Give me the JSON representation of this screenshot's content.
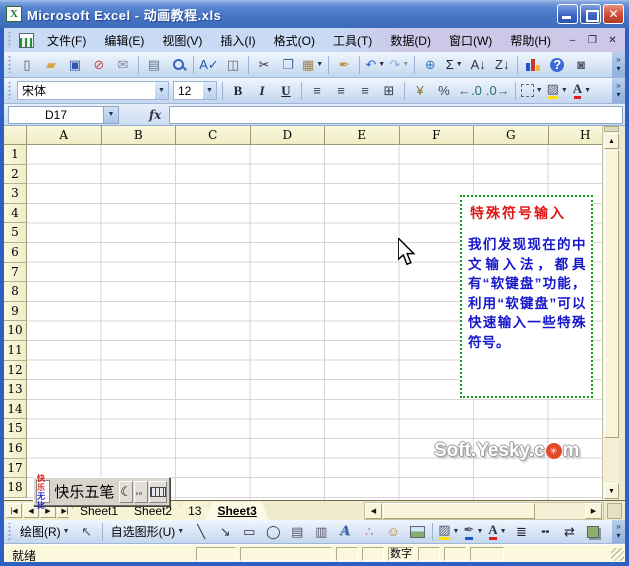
{
  "window": {
    "title": "Microsoft Excel - 动画教程.xls",
    "app_icon_glyph": "X"
  },
  "icons": {
    "dd": "▼",
    "up": "▲",
    "down": "▼",
    "left": "◀",
    "right": "▶"
  },
  "toolbar_overflow": {
    "top": "»",
    "bottom": "▾"
  },
  "colors": {
    "titlebar_blue": "#4674C4",
    "header_yellow": "#F6F3CF",
    "note_border": "#12A012",
    "note_title": "#E01818",
    "note_body": "#1515CC",
    "watermark_red": "#E24A2A",
    "fill_yellow": "#FFE400",
    "font_red": "#E02020",
    "line_blue": "#2255CC"
  },
  "menu_bar": {
    "items": [
      "文件(F)",
      "编辑(E)",
      "视图(V)",
      "插入(I)",
      "格式(O)",
      "工具(T)",
      "数据(D)",
      "窗口(W)",
      "帮助(H)"
    ],
    "window_buttons": [
      "–",
      "❐",
      "✕"
    ]
  },
  "standard_toolbar": {
    "items": [
      {
        "name": "new",
        "glyph": "▯",
        "color": "#556"
      },
      {
        "name": "open",
        "glyph": "▰",
        "color": "#D9A43B"
      },
      {
        "name": "save",
        "glyph": "▣",
        "color": "#3458A8"
      },
      {
        "name": "permission",
        "glyph": "⊘",
        "color": "#C44"
      },
      {
        "name": "mail",
        "glyph": "✉",
        "color": "#7A88A8"
      },
      {
        "sep": true
      },
      {
        "name": "print",
        "glyph": "▤",
        "color": "#66788C"
      },
      {
        "name": "print-preview",
        "cls": "ic-magnifier"
      },
      {
        "sep": true
      },
      {
        "name": "spelling",
        "glyph": "A✓",
        "color": "#2255AA"
      },
      {
        "name": "research",
        "glyph": "◫",
        "color": "#667"
      },
      {
        "sep": true
      },
      {
        "name": "cut",
        "glyph": "✂",
        "color": "#334"
      },
      {
        "name": "copy",
        "glyph": "❐",
        "color": "#4A6FA5"
      },
      {
        "name": "paste",
        "glyph": "▦",
        "color": "#A0824A",
        "dd": true
      },
      {
        "sep": true
      },
      {
        "name": "format-painter",
        "glyph": "✒",
        "color": "#B8953A"
      },
      {
        "sep": true
      },
      {
        "name": "undo",
        "glyph": "↶",
        "color": "#2E62C8",
        "dd": true
      },
      {
        "name": "redo",
        "glyph": "↷",
        "color": "#2E62C8",
        "dd": true,
        "dis": true
      },
      {
        "sep": true
      },
      {
        "name": "hyperlink",
        "glyph": "⊕",
        "color": "#3A7AC8"
      },
      {
        "name": "autosum",
        "glyph": "Σ",
        "color": "#222",
        "dd": true
      },
      {
        "name": "sort-ascending",
        "glyph": "A↓",
        "color": "#334"
      },
      {
        "name": "sort-descending",
        "glyph": "Z↓",
        "color": "#334"
      },
      {
        "sep": true
      },
      {
        "name": "chart-wizard",
        "cls": "ic-chart"
      },
      {
        "name": "help",
        "glyph": "?",
        "cls": "ic-help"
      },
      {
        "name": "camera",
        "glyph": "◙",
        "color": "#556"
      }
    ]
  },
  "formatting_toolbar": {
    "font_name": "宋体",
    "font_size": "12",
    "items": [
      {
        "name": "bold",
        "glyph": "B",
        "cls": "fw",
        "color": "#223"
      },
      {
        "name": "italic",
        "glyph": "I",
        "cls": "fi",
        "color": "#223"
      },
      {
        "name": "underline",
        "glyph": "U",
        "cls": "fu",
        "color": "#223"
      },
      {
        "sep": true
      },
      {
        "name": "align-left",
        "glyph": "≡",
        "color": "#345"
      },
      {
        "name": "align-center",
        "glyph": "≡",
        "color": "#345"
      },
      {
        "name": "align-right",
        "glyph": "≡",
        "color": "#345"
      },
      {
        "name": "merge-center",
        "glyph": "⊞",
        "color": "#345"
      },
      {
        "sep": true
      },
      {
        "name": "currency-style",
        "glyph": "¥",
        "color": "#8A6A2A"
      },
      {
        "name": "percent-style",
        "glyph": "%",
        "color": "#445"
      },
      {
        "name": "increase-decimal",
        "glyph": "←.0",
        "color": "#2E6E6E"
      },
      {
        "name": "decrease-decimal",
        "glyph": ".0→",
        "color": "#2E6E6E"
      },
      {
        "sep": true
      },
      {
        "name": "borders",
        "cls": "ic-border",
        "dd": true
      },
      {
        "name": "fill-color",
        "glyph": "▨",
        "color": "#556",
        "bar": "#FFE400",
        "dd": true
      },
      {
        "name": "font-color",
        "glyph": "A",
        "cls": "fw",
        "color": "#334",
        "bar": "#E02020",
        "dd": true
      }
    ]
  },
  "formula_bar": {
    "name_box": "D17",
    "fx_label": "fx",
    "formula": ""
  },
  "grid": {
    "columns": [
      "A",
      "B",
      "C",
      "D",
      "E",
      "F",
      "G",
      "H"
    ],
    "rows": [
      "1",
      "2",
      "3",
      "4",
      "5",
      "6",
      "7",
      "8",
      "9",
      "10",
      "11",
      "12",
      "13",
      "14",
      "15",
      "16",
      "17",
      "18"
    ]
  },
  "note_box": {
    "title": "特殊符号输入",
    "body": "我们发现现在的中文输入法，都具有“软键盘”功能，利用“软键盘”可以快速输入一些特殊符号。"
  },
  "watermark": {
    "prefix": "Soft.Yesky.c",
    "logo_glyph": "✳",
    "suffix": "m"
  },
  "ime_bar": {
    "badge_top": "快乐",
    "badge_bottom": "无比",
    "name": "快乐五笔",
    "moon_glyph": "☾",
    "punctuation_glyph": "，。"
  },
  "sheet_tabs": {
    "nav": [
      "|◀",
      "◀",
      "▶",
      "▶|"
    ],
    "tabs": [
      {
        "label": "Sheet1",
        "active": false
      },
      {
        "label": "Sheet2",
        "active": false
      },
      {
        "label": "13",
        "active": false
      },
      {
        "label": "Sheet3",
        "active": true
      }
    ]
  },
  "drawing_toolbar": {
    "items": [
      {
        "name": "draw-menu",
        "label": "绘图(R)",
        "dd": true
      },
      {
        "name": "select-pointer",
        "glyph": "↖",
        "color": "#556"
      },
      {
        "sep": true
      },
      {
        "name": "autoshapes-menu",
        "label": "自选图形(U)",
        "dd": true
      },
      {
        "name": "line",
        "glyph": "╲",
        "color": "#334"
      },
      {
        "name": "arrow",
        "glyph": "↘",
        "color": "#334"
      },
      {
        "name": "rectangle",
        "glyph": "▭",
        "color": "#334"
      },
      {
        "name": "oval",
        "glyph": "◯",
        "color": "#334"
      },
      {
        "name": "text-box",
        "glyph": "▤",
        "color": "#556"
      },
      {
        "name": "vertical-text-box",
        "glyph": "▥",
        "color": "#556"
      },
      {
        "name": "wordart",
        "glyph": "A",
        "cls": "ic-wordart"
      },
      {
        "name": "diagram",
        "glyph": "∴",
        "color": "#B86A4A"
      },
      {
        "name": "clip-art",
        "glyph": "☺",
        "color": "#C87A2A"
      },
      {
        "name": "picture",
        "cls": "ic-picture"
      },
      {
        "sep": true
      },
      {
        "name": "fill-color",
        "glyph": "▨",
        "color": "#556",
        "bar": "#FFE400",
        "dd": true
      },
      {
        "name": "line-color",
        "glyph": "✒",
        "color": "#556",
        "bar": "#2255CC",
        "dd": true
      },
      {
        "name": "font-color",
        "glyph": "A",
        "cls": "fw",
        "color": "#334",
        "bar": "#E02020",
        "dd": true
      },
      {
        "name": "line-style",
        "glyph": "≣",
        "color": "#223"
      },
      {
        "name": "dash-style",
        "glyph": "╍",
        "color": "#223"
      },
      {
        "name": "arrow-style",
        "glyph": "⇄",
        "color": "#223"
      },
      {
        "name": "shadow-style",
        "cls": "ic-shadow"
      }
    ]
  },
  "status_bar": {
    "ready": "就绪",
    "panels": [
      "",
      "",
      "",
      "",
      "数字",
      "",
      "",
      ""
    ]
  }
}
